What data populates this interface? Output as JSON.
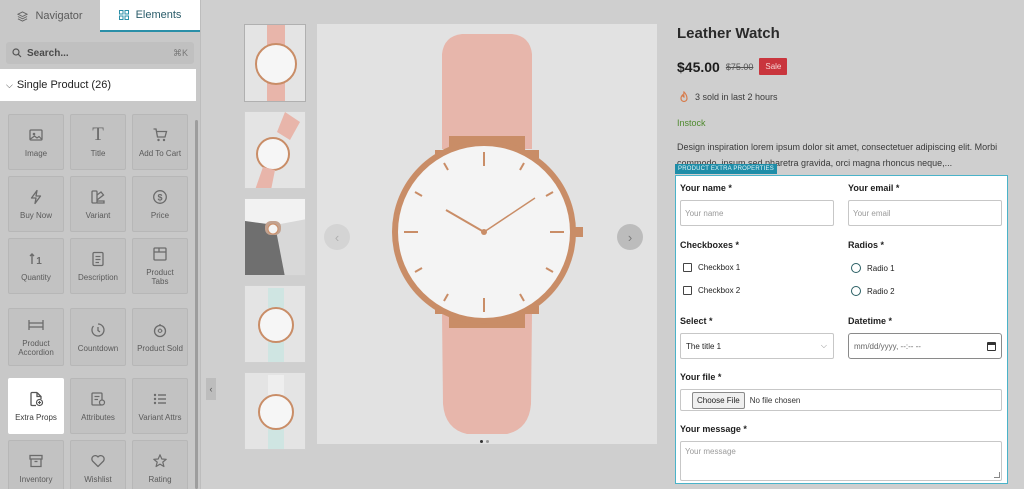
{
  "sidebar": {
    "tabs": [
      {
        "label": "Navigator",
        "icon": "layers-icon"
      },
      {
        "label": "Elements",
        "icon": "grid-icon"
      }
    ],
    "search": {
      "placeholder": "Search...",
      "shortcut": "⌘K"
    },
    "section": {
      "label": "Single Product (26)"
    },
    "widgets": [
      {
        "label": "Image",
        "icon": "image-icon"
      },
      {
        "label": "Title",
        "icon": "title-icon"
      },
      {
        "label": "Add To Cart",
        "icon": "cart-icon"
      },
      {
        "label": "Buy Now",
        "icon": "lightning-icon"
      },
      {
        "label": "Variant",
        "icon": "variant-icon"
      },
      {
        "label": "Price",
        "icon": "dollar-icon"
      },
      {
        "label": "Quantity",
        "icon": "quantity-icon"
      },
      {
        "label": "Description",
        "icon": "document-icon"
      },
      {
        "label": "Product Tabs",
        "icon": "tabs-icon"
      },
      {
        "label": "Product Accordion",
        "icon": "accordion-icon"
      },
      {
        "label": "Countdown",
        "icon": "countdown-icon"
      },
      {
        "label": "Product Sold",
        "icon": "sold-icon"
      },
      {
        "label": "Extra Props",
        "icon": "file-plus-icon"
      },
      {
        "label": "Attributes",
        "icon": "attributes-icon"
      },
      {
        "label": "Variant Attrs",
        "icon": "list-icon"
      },
      {
        "label": "Inventory",
        "icon": "inventory-icon"
      },
      {
        "label": "Wishlist",
        "icon": "heart-icon"
      },
      {
        "label": "Rating",
        "icon": "star-icon"
      }
    ]
  },
  "product": {
    "title": "Leather Watch",
    "price": "$45.00",
    "old_price": "$75.00",
    "sale_badge": "Sale",
    "sold_text": "3 sold in last 2 hours",
    "stock": "Instock",
    "description": "Design inspiration lorem ipsum dolor sit amet, consectetuer adipiscing elit. Morbi commodo, ipsum sed pharetra gravida, orci magna rhoncus neque,..."
  },
  "form": {
    "tag": "PRODUCT EXTRA PROPERTIES",
    "name_label": "Your name *",
    "name_placeholder": "Your name",
    "email_label": "Your email *",
    "email_placeholder": "Your email",
    "checkboxes_label": "Checkboxes *",
    "checkbox1": "Checkbox 1",
    "checkbox2": "Checkbox 2",
    "radios_label": "Radios *",
    "radio1": "Radio 1",
    "radio2": "Radio 2",
    "select_label": "Select *",
    "select_value": "The title 1",
    "datetime_label": "Datetime *",
    "datetime_value": "mm/dd/yyyy, --:-- --",
    "file_label": "Your file *",
    "file_button": "Choose File",
    "file_status": "No file chosen",
    "message_label": "Your message *",
    "message_placeholder": "Your message"
  },
  "colors": {
    "accent": "#1e8da8",
    "sale": "#c9353d",
    "instock": "#4f8a2e",
    "strap": "#e7b6ab",
    "gold": "#c98d67"
  }
}
